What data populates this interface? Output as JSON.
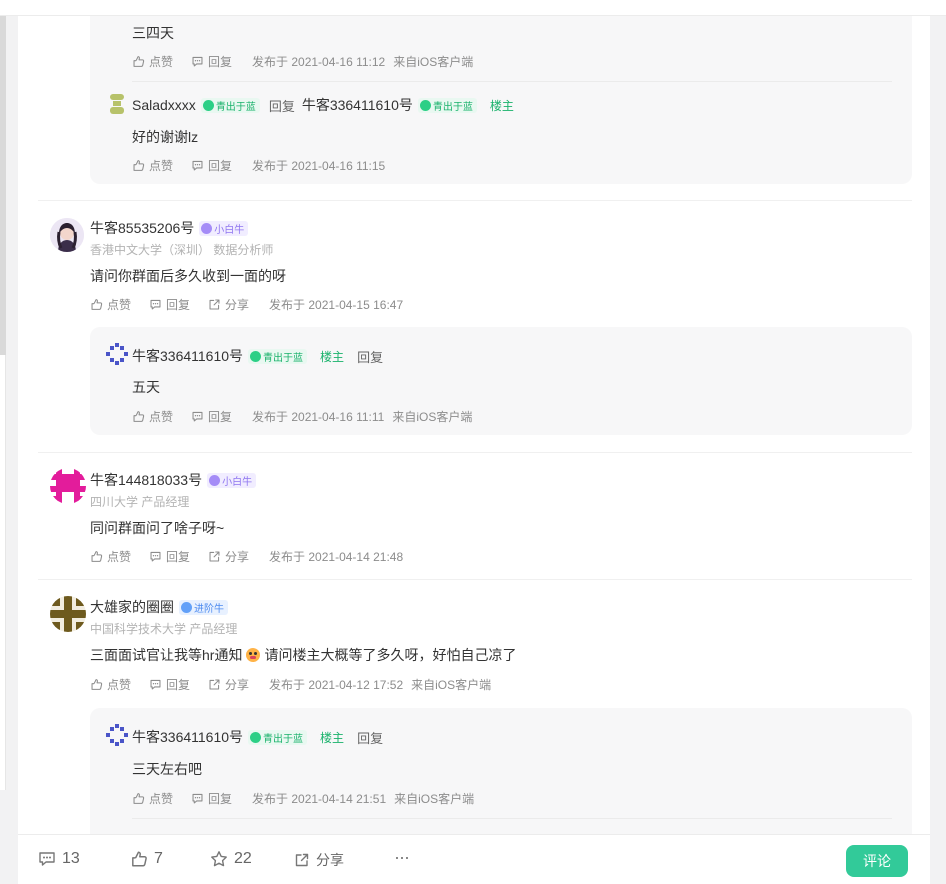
{
  "labels": {
    "like": "点赞",
    "reply": "回复",
    "share": "分享",
    "louzhu": "楼主"
  },
  "thread1": {
    "reply1": {
      "text": "三四天",
      "meta": "发布于 2021-04-16 11:12",
      "source": "来自iOS客户端"
    },
    "reply2": {
      "user": "Saladxxxx",
      "badge": "青出于蓝",
      "reply_word": "回复",
      "target": "牛客336411610号",
      "target_badge": "青出于蓝",
      "text": "好的谢谢lz",
      "meta": "发布于 2021-04-16 11:15"
    }
  },
  "comment1": {
    "user": "牛客85535206号",
    "badge": "小白牛",
    "school": "香港中文大学（深圳） 数据分析师",
    "text": "请问你群面后多久收到一面的呀",
    "meta": "发布于 2021-04-15 16:47",
    "reply": {
      "user": "牛客336411610号",
      "badge": "青出于蓝",
      "text": "五天",
      "meta": "发布于 2021-04-16 11:11",
      "source": "来自iOS客户端"
    }
  },
  "comment2": {
    "user": "牛客144818033号",
    "badge": "小白牛",
    "school": "四川大学 产品经理",
    "text": "同问群面问了啥子呀~",
    "meta": "发布于 2021-04-14 21:48"
  },
  "comment3": {
    "user": "大雄家的圈圈",
    "badge": "进阶牛",
    "school": "中国科学技术大学 产品经理",
    "text_before": "三面面试官让我等hr通知",
    "text_after": "请问楼主大概等了多久呀，好怕自己凉了",
    "meta": "发布于 2021-04-12 17:52",
    "source": "来自iOS客户端",
    "reply": {
      "user": "牛客336411610号",
      "badge": "青出于蓝",
      "text": "三天左右吧",
      "meta": "发布于 2021-04-14 21:51",
      "source": "来自iOS客户端"
    }
  },
  "bottom_bar": {
    "comments": "13",
    "likes": "7",
    "stars": "22",
    "share": "分享",
    "more": "···",
    "comment_button": "评论"
  },
  "colors": {
    "accent": "#32ca99",
    "badge_green": "#19b26b",
    "badge_purple": "#8f75f0",
    "badge_blue": "#4d8bf0",
    "reply_bg": "#f7f7f8"
  },
  "icons": [
    "thumb-up-icon",
    "chat-icon",
    "share-icon",
    "star-icon",
    "more-icon"
  ]
}
